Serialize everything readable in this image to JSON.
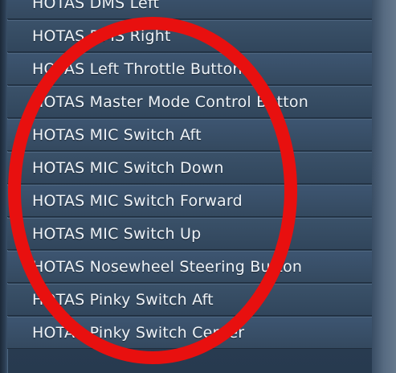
{
  "list": {
    "items": [
      {
        "label": "HOTAS DMS Left"
      },
      {
        "label": "HOTAS DMS Right"
      },
      {
        "label": "HOTAS Left Throttle Button"
      },
      {
        "label": "HOTAS Master Mode Control Button"
      },
      {
        "label": "HOTAS MIC Switch Aft"
      },
      {
        "label": "HOTAS MIC Switch Down"
      },
      {
        "label": "HOTAS MIC Switch Forward"
      },
      {
        "label": "HOTAS MIC Switch Up"
      },
      {
        "label": "HOTAS Nosewheel Steering Button"
      },
      {
        "label": "HOTAS Pinky Switch Aft"
      },
      {
        "label": "HOTAS Pinky Switch Center"
      }
    ]
  },
  "annotation": {
    "color": "#e8100f"
  },
  "colors": {
    "row_background": "#3a5169",
    "text": "#eef3f8"
  }
}
